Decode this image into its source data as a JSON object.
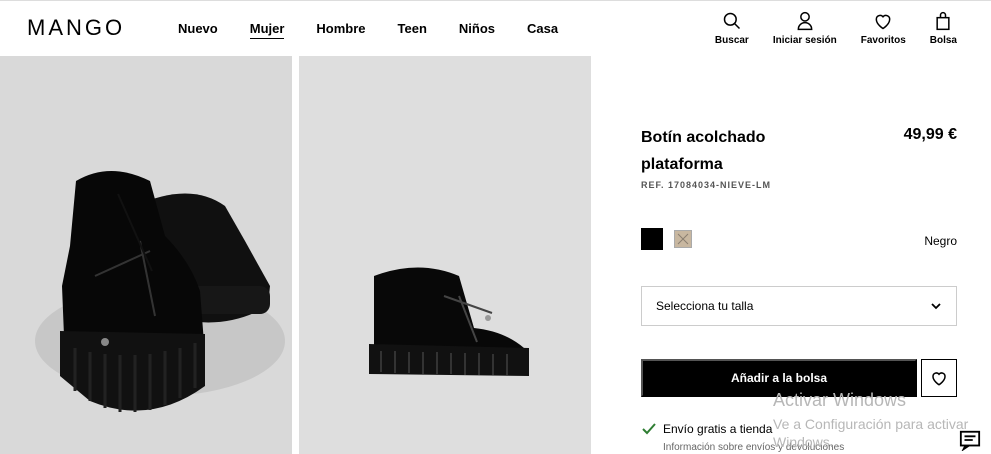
{
  "header": {
    "logo": "MANGO",
    "nav": [
      "Nuevo",
      "Mujer",
      "Hombre",
      "Teen",
      "Niños",
      "Casa"
    ],
    "active_nav": "Mujer",
    "tools": {
      "search": "Buscar",
      "login": "Iniciar sesión",
      "favorites": "Favoritos",
      "bag": "Bolsa"
    }
  },
  "product": {
    "title": "Botín acolchado plataforma",
    "price": "49,99 €",
    "ref": "REF. 17084034-NIEVE-LM",
    "color_name": "Negro",
    "size_placeholder": "Selecciona tu talla",
    "add_to_bag": "Añadir a la bolsa",
    "shipping": "Envío gratis a tienda",
    "shipping_info": "Información sobre envíos y devoluciones"
  },
  "colors": {
    "selected": "#000000",
    "alternate": "#c8b7a0",
    "image_bg": "#dadada",
    "ship_check": "#2e7d32"
  },
  "watermark": {
    "line1": "Activar Windows",
    "line2": "Ve a Configuración para activar Windows."
  },
  "icons": [
    "search-icon",
    "user-icon",
    "heart-icon",
    "bag-icon",
    "chevron-down-icon",
    "check-icon",
    "chat-icon"
  ]
}
